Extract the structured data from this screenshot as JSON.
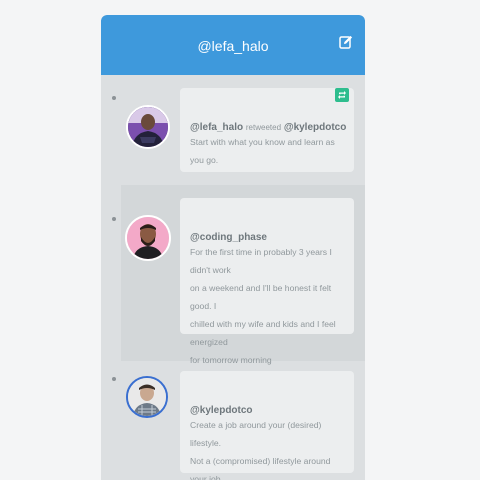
{
  "header": {
    "title": "@lefa_halo",
    "compose_icon": "edit-icon"
  },
  "tweets": [
    {
      "handle": "@lefa_halo",
      "verb": "retweeted",
      "target": "@kylepdotco",
      "text": [
        "Start with what you know and learn as you go."
      ],
      "retweet_icon": "retweet-icon",
      "avatar": "avatar-man-purple-shirt"
    },
    {
      "handle": "@coding_phase",
      "text": [
        "For the first time in probably 3 years I didn't work",
        "on a weekend and I'll be honest it felt good. I",
        "chilled with my wife and kids and I feel energized",
        "for tomorrow morning"
      ],
      "avatar": "avatar-bearded-man-pink"
    },
    {
      "handle": "@kylepdotco",
      "text": [
        "Create a job around your (desired) lifestyle.",
        "Not a (compromised) lifestyle around your job."
      ],
      "avatar": "avatar-man-checked-shirt"
    }
  ],
  "colors": {
    "header": "#3e99dc",
    "badge": "#2ebd8e",
    "feed_bg": "#dcdfe1",
    "card_bg": "#eceeef"
  }
}
